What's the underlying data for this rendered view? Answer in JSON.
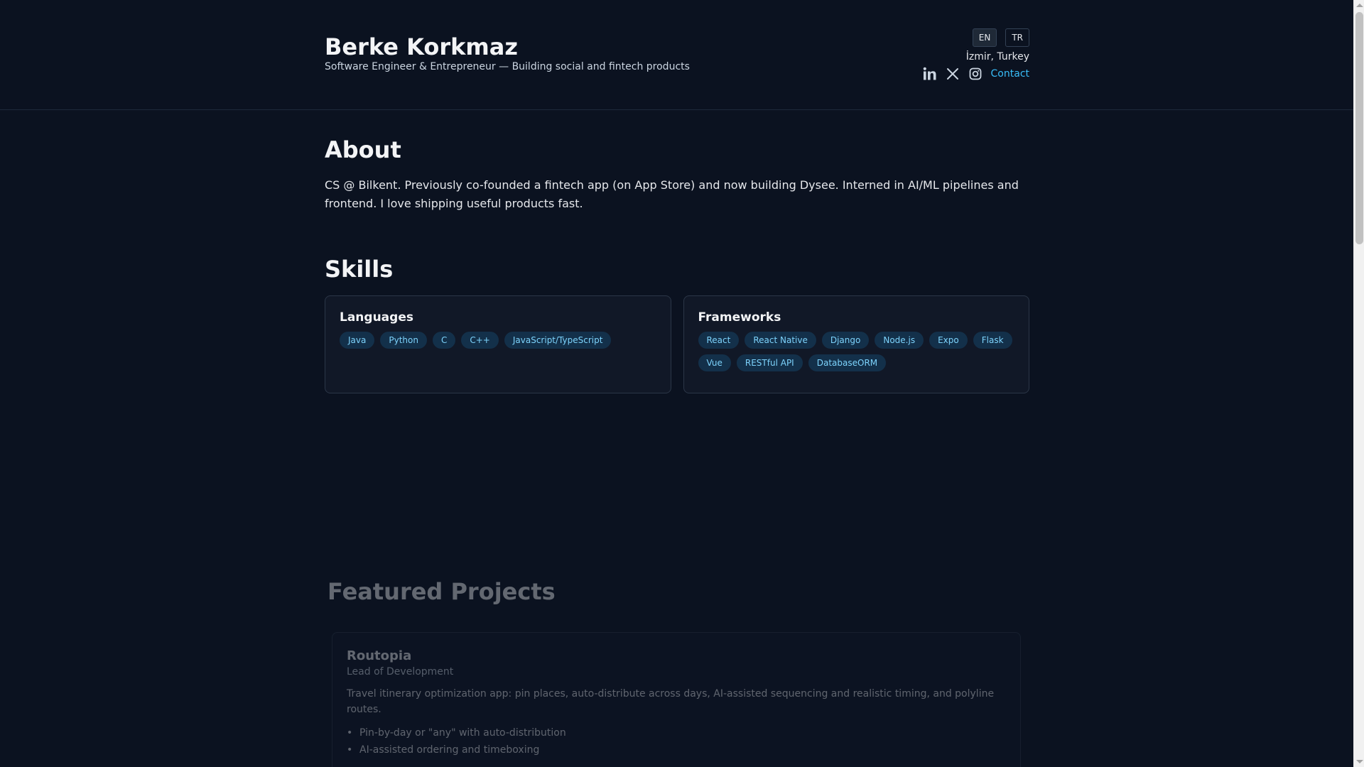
{
  "header": {
    "name": "Berke Korkmaz",
    "tagline": "Software Engineer & Entrepreneur — Building social and fintech products",
    "languages": [
      {
        "label": "EN"
      },
      {
        "label": "TR"
      }
    ],
    "location": "İzmir, Turkey",
    "social_icons": [
      "linkedin-icon",
      "x-icon",
      "instagram-icon"
    ],
    "contact_label": "Contact"
  },
  "about": {
    "title": "About",
    "text": "CS @ Bilkent. Previously co-founded a fintech app (on App Store) and now building Dysee. Interned in AI/ML pipelines and frontend. I love shipping useful products fast."
  },
  "skills": {
    "title": "Skills",
    "groups": [
      {
        "title": "Languages",
        "items": [
          "Java",
          "Python",
          "C",
          "C++",
          "JavaScript/TypeScript"
        ]
      },
      {
        "title": "Frameworks",
        "items": [
          "React",
          "React Native",
          "Django",
          "Node.js",
          "Expo",
          "Flask",
          "Vue",
          "RESTful API",
          "DatabaseORM"
        ]
      }
    ]
  },
  "featured": {
    "title": "Featured Projects",
    "projects": [
      {
        "name": "Routopia",
        "role": "Lead of Development",
        "description": "Travel itinerary optimization app: pin places, auto-distribute across days, AI-assisted sequencing and realistic timing, and polyline routes.",
        "bullets": [
          "Pin-by-day or \"any\" with auto-distribution",
          "AI-assisted ordering and timeboxing"
        ]
      }
    ]
  },
  "colors": {
    "background": "#0b1220",
    "accent": "#38bdf8",
    "chip_bg": "#13304a"
  }
}
